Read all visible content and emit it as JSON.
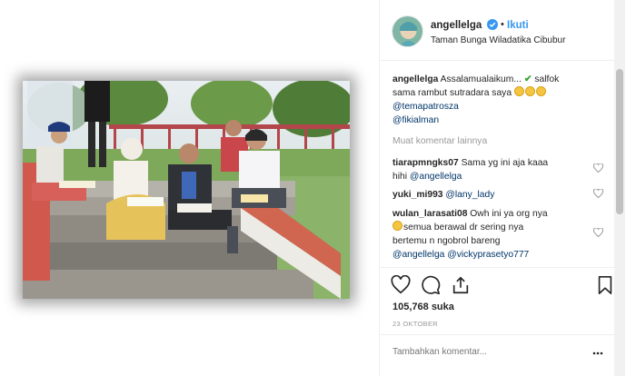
{
  "header": {
    "username": "angellelga",
    "follow_label": "Ikuti",
    "separator": "•",
    "location": "Taman Bunga Wiladatika Cibubur"
  },
  "caption": {
    "username": "angellelga",
    "text_1": "Assalamualaikum...",
    "text_2": "salfok",
    "text_3": "sama rambut sutradara saya",
    "mention_1": "@temapatrosza",
    "mention_2": "@fikialman"
  },
  "load_more": "Muat komentar lainnya",
  "comments": [
    {
      "username": "tiarapmngks07",
      "text": "Sama yg ini aja kaaa",
      "text_2": "hihi",
      "mention": "@angellelga"
    },
    {
      "username": "yuki_mi993",
      "text": "",
      "mention": "@lany_lady"
    },
    {
      "username": "wulan_larasati08",
      "text": "Owh ini ya org nya",
      "text_2": "semua berawal dr sering nya",
      "text_3": "bertemu n ngobrol bareng",
      "mention": "@angellelga",
      "mention_2": "@vickyprasetyo777"
    }
  ],
  "post": {
    "likes": "105,768 suka",
    "date": "23 OKTOBER"
  },
  "add_comment": {
    "placeholder": "Tambahkan komentar..."
  },
  "colors": {
    "accent": "#3897f0",
    "mention": "#003569",
    "muted": "#999999"
  },
  "icons": {
    "verified": "verified-badge-icon",
    "heart": "heart-icon",
    "comment": "comment-icon",
    "share": "share-icon",
    "save": "bookmark-icon",
    "more": "more-options-icon"
  }
}
